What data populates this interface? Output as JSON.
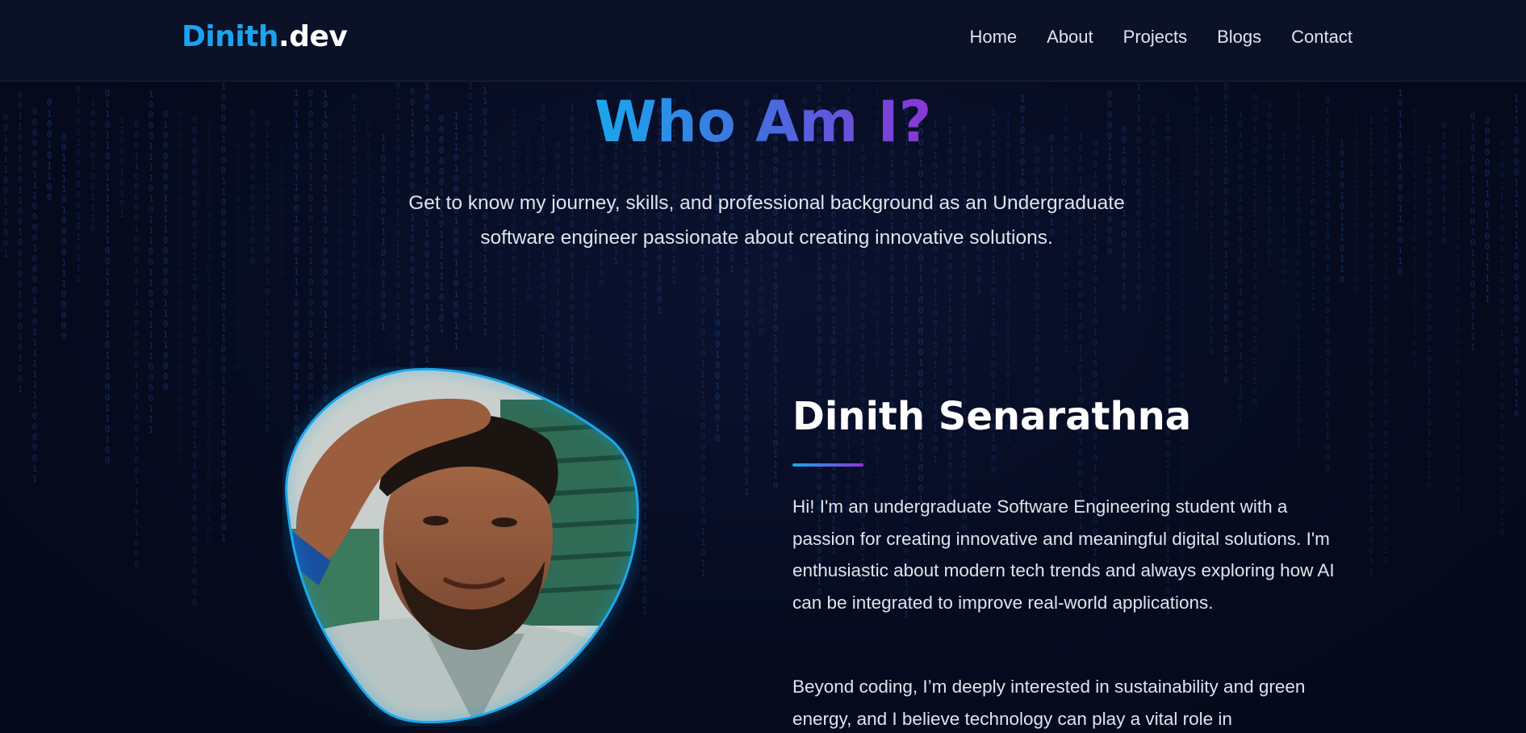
{
  "navbar": {
    "logo_brand": "Dinith",
    "logo_tld": ".dev",
    "links": [
      "Home",
      "About",
      "Projects",
      "Blogs",
      "Contact"
    ]
  },
  "section": {
    "title": "Who Am I?",
    "subtitle": "Get to know my journey, skills, and professional background as an Undergraduate software engineer passionate about creating innovative solutions."
  },
  "profile": {
    "name": "Dinith Senarathna",
    "bio_paragraphs": [
      "Hi! I'm an undergraduate Software Engineering student with a passion for creating innovative and meaningful digital solutions. I'm enthusiastic about modern tech trends and always exploring how AI can be integrated to improve real-world applications.",
      "Beyond coding, I’m deeply interested in sustainability and green energy, and I believe technology can play a vital role in"
    ],
    "photo": "profile-photo"
  },
  "colors": {
    "background": "#050a1c",
    "navbar": "#0b1126",
    "accent_blue": "#1aa7ee",
    "accent_purple": "#8a35d6",
    "matrix": "#1b3a6e"
  }
}
